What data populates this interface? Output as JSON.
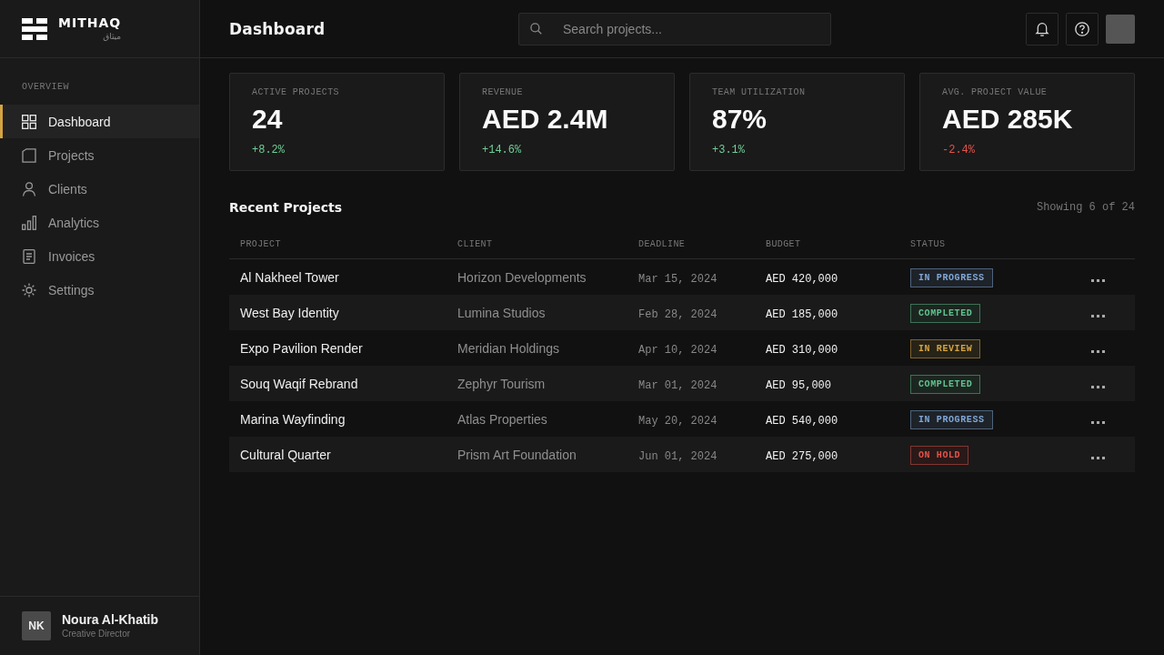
{
  "sidebar": {
    "brand": {
      "name": "MITHAQ",
      "subtitle": "ميثاق"
    },
    "section_label": "OVERVIEW",
    "items": [
      {
        "label": "Dashboard",
        "selected": true
      },
      {
        "label": "Projects",
        "selected": false
      },
      {
        "label": "Clients",
        "selected": false
      },
      {
        "label": "Analytics",
        "selected": false
      },
      {
        "label": "Invoices",
        "selected": false
      },
      {
        "label": "Settings",
        "selected": false
      }
    ],
    "user": {
      "initials": "NK",
      "name": "Noura Al-Khatib",
      "role": "Creative Director"
    }
  },
  "header": {
    "title": "Dashboard",
    "search": {
      "placeholder": "Search projects..."
    }
  },
  "stats": [
    {
      "label": "ACTIVE PROJECTS",
      "value": "24",
      "change": "+8.2%",
      "negative": false
    },
    {
      "label": "REVENUE",
      "value": "AED 2.4M",
      "change": "+14.6%",
      "negative": false
    },
    {
      "label": "TEAM UTILIZATION",
      "value": "87%",
      "change": "+3.1%",
      "negative": false
    },
    {
      "label": "AVG. PROJECT VALUE",
      "value": "AED 285K",
      "change": "-2.4%",
      "negative": true
    }
  ],
  "recent_projects": {
    "title": "Recent Projects",
    "summary": "Showing 6 of 24",
    "table": {
      "columns": [
        "PROJECT",
        "CLIENT",
        "DEADLINE",
        "BUDGET",
        "STATUS"
      ],
      "rows": [
        {
          "project": "Al Nakheel Tower",
          "client": "Horizon Developments",
          "deadline": "Mar 15, 2024",
          "budget": "AED 420,000",
          "status": {
            "label": "IN PROGRESS",
            "color": "#7fa6d6"
          }
        },
        {
          "project": "West Bay Identity",
          "client": "Lumina Studios",
          "deadline": "Feb 28, 2024",
          "budget": "AED 185,000",
          "status": {
            "label": "COMPLETED",
            "color": "#62c28e"
          }
        },
        {
          "project": "Expo Pavilion Render",
          "client": "Meridian Holdings",
          "deadline": "Apr 10, 2024",
          "budget": "AED 310,000",
          "status": {
            "label": "IN REVIEW",
            "color": "#d4a443"
          }
        },
        {
          "project": "Souq Waqif Rebrand",
          "client": "Zephyr Tourism",
          "deadline": "Mar 01, 2024",
          "budget": "AED 95,000",
          "status": {
            "label": "COMPLETED",
            "color": "#62c28e"
          }
        },
        {
          "project": "Marina Wayfinding",
          "client": "Atlas Properties",
          "deadline": "May 20, 2024",
          "budget": "AED 540,000",
          "status": {
            "label": "IN PROGRESS",
            "color": "#7fa6d6"
          }
        },
        {
          "project": "Cultural Quarter",
          "client": "Prism Art Foundation",
          "deadline": "Jun 01, 2024",
          "budget": "AED 275,000",
          "status": {
            "label": "ON HOLD",
            "color": "#e0544b"
          }
        }
      ]
    }
  }
}
